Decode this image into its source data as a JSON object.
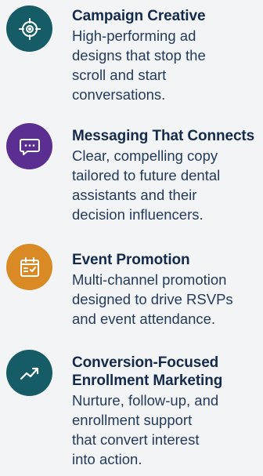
{
  "colors": {
    "teal": "#155c66",
    "purple": "#5b2f92",
    "orange": "#d98a25",
    "title": "#142a4c",
    "body": "#243a5c",
    "background": "#f3f4f5"
  },
  "services": [
    {
      "icon": "target-icon",
      "title": "Campaign Creative",
      "description_lines": [
        "High-performing ad",
        "designs that stop the",
        "scroll and start",
        "conversations."
      ]
    },
    {
      "icon": "chat-bubble-icon",
      "title": "Messaging That Connects",
      "description_lines": [
        "Clear, compelling copy",
        "tailored to future dental",
        "assistants and their",
        "decision influencers."
      ]
    },
    {
      "icon": "calendar-icon",
      "title": "Event Promotion",
      "description_lines": [
        "Multi-channel promotion",
        "designed to drive RSVPs",
        "and event attendance."
      ]
    },
    {
      "icon": "trend-up-icon",
      "title_lines": [
        "Conversion-Focused",
        "Enrollment Marketing"
      ],
      "description_lines": [
        "Nurture, follow-up, and",
        "enrollment support",
        "that convert interest",
        "into action."
      ]
    }
  ]
}
